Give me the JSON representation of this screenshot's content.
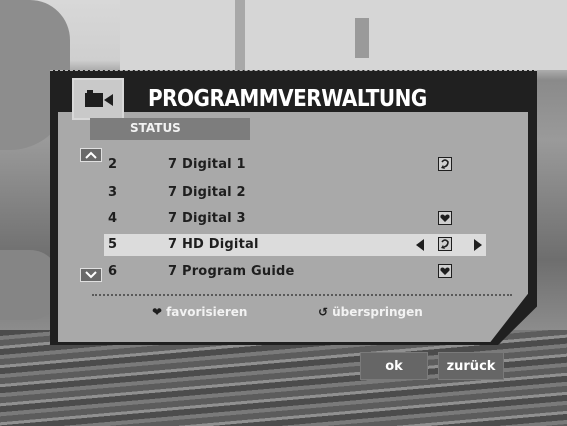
{
  "header": {
    "title": "PROGRAMMVERWALTUNG",
    "icon": "camera-icon"
  },
  "tab": {
    "label": "STATUS"
  },
  "channels": [
    {
      "number": "2",
      "name": "7 Digital 1",
      "icon": "skip-icon"
    },
    {
      "number": "3",
      "name": "7 Digital 2",
      "icon": ""
    },
    {
      "number": "4",
      "name": "7 Digital 3",
      "icon": "favorite-icon"
    },
    {
      "number": "5",
      "name": "7 HD Digital",
      "icon": "skip-icon"
    },
    {
      "number": "6",
      "name": "7 Program Guide",
      "icon": "favorite-icon"
    }
  ],
  "selected_index": 3,
  "legend": {
    "favorite": "favorisieren",
    "skip": "überspringen"
  },
  "buttons": {
    "ok": "ok",
    "back": "zurück"
  },
  "colors": {
    "panel_dark": "#202020",
    "panel_light": "#a9a9a9",
    "highlight": "#dcdcdc",
    "tab": "#7d7d7d"
  }
}
